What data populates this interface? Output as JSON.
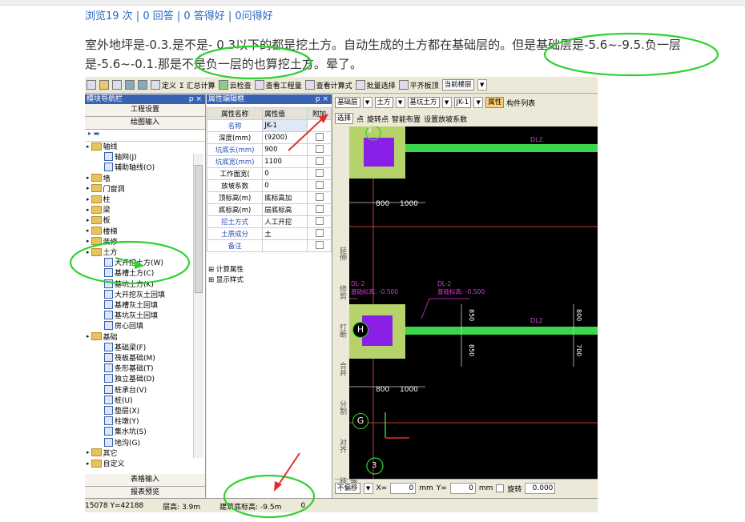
{
  "stats_line": "浏览19 次 | 0 回答 | 0 答得好 | 0问得好",
  "paragraph": "室外地坪是-0.3.是不是- 0.3以下的都是挖土方。自动生成的土方都在基础层的。但是基础层是-5.6~-9.5.负一层是-5.6~-0.1.那是不是负一层的也算挖土方。晕了。",
  "toolbar": {
    "items": [
      "定义",
      "Σ 汇总计算",
      "云检查",
      "查看工程量",
      "查看计算式",
      "批量选择",
      "平齐板顶",
      "当前楼层"
    ]
  },
  "nav": {
    "title": "模块导航栏",
    "pin": "p  ×",
    "buttons": [
      "工程设置",
      "绘图输入"
    ],
    "bottom_buttons": [
      "表格输入",
      "报表预览"
    ],
    "tree": [
      {
        "label": "轴线",
        "level": 0,
        "type": "folder"
      },
      {
        "label": "轴网(J)",
        "level": 1,
        "type": "leaf"
      },
      {
        "label": "辅助轴线(O)",
        "level": 1,
        "type": "leaf"
      },
      {
        "label": "墙",
        "level": 0,
        "type": "folder"
      },
      {
        "label": "门窗洞",
        "level": 0,
        "type": "folder"
      },
      {
        "label": "柱",
        "level": 0,
        "type": "folder"
      },
      {
        "label": "梁",
        "level": 0,
        "type": "folder"
      },
      {
        "label": "板",
        "level": 0,
        "type": "folder"
      },
      {
        "label": "楼梯",
        "level": 0,
        "type": "folder"
      },
      {
        "label": "装修",
        "level": 0,
        "type": "folder"
      },
      {
        "label": "土方",
        "level": 0,
        "type": "folder"
      },
      {
        "label": "大开挖土方(W)",
        "level": 1,
        "type": "leaf"
      },
      {
        "label": "基槽土方(C)",
        "level": 1,
        "type": "leaf"
      },
      {
        "label": "基坑土方(K)",
        "level": 1,
        "type": "leaf"
      },
      {
        "label": "大开挖灰土回填",
        "level": 1,
        "type": "leaf"
      },
      {
        "label": "基槽灰土回填",
        "level": 1,
        "type": "leaf"
      },
      {
        "label": "基坑灰土回填",
        "level": 1,
        "type": "leaf"
      },
      {
        "label": "房心回填",
        "level": 1,
        "type": "leaf"
      },
      {
        "label": "基础",
        "level": 0,
        "type": "folder"
      },
      {
        "label": "基础梁(F)",
        "level": 1,
        "type": "leaf"
      },
      {
        "label": "筏板基础(M)",
        "level": 1,
        "type": "leaf"
      },
      {
        "label": "条形基础(T)",
        "level": 1,
        "type": "leaf"
      },
      {
        "label": "独立基础(D)",
        "level": 1,
        "type": "leaf"
      },
      {
        "label": "桩承台(V)",
        "level": 1,
        "type": "leaf"
      },
      {
        "label": "桩(U)",
        "level": 1,
        "type": "leaf"
      },
      {
        "label": "垫层(X)",
        "level": 1,
        "type": "leaf"
      },
      {
        "label": "柱墩(Y)",
        "level": 1,
        "type": "leaf"
      },
      {
        "label": "集水坑(S)",
        "level": 1,
        "type": "leaf"
      },
      {
        "label": "地沟(G)",
        "level": 1,
        "type": "leaf"
      },
      {
        "label": "其它",
        "level": 0,
        "type": "folder"
      },
      {
        "label": "自定义",
        "level": 0,
        "type": "folder"
      }
    ]
  },
  "props": {
    "title": "属性编辑框",
    "pin": "p  ×",
    "headers": [
      "属性名称",
      "属性值",
      "附加"
    ],
    "rows": [
      {
        "name": "名称",
        "value": "JK-1",
        "blue": true
      },
      {
        "name": "深度(mm)",
        "value": "(9200)",
        "blue": false
      },
      {
        "name": "坑底长(mm)",
        "value": "900",
        "blue": true
      },
      {
        "name": "坑底宽(mm)",
        "value": "1100",
        "blue": true
      },
      {
        "name": "工作面宽(",
        "value": "0",
        "blue": false
      },
      {
        "name": "放坡系数",
        "value": "0",
        "blue": false
      },
      {
        "name": "顶标高(m)",
        "value": "底标高加",
        "blue": false
      },
      {
        "name": "底标高(m)",
        "value": "层底标高",
        "blue": false
      },
      {
        "name": "挖土方式",
        "value": "人工开挖",
        "blue": true
      },
      {
        "name": "土质成分",
        "value": "土",
        "blue": true
      },
      {
        "name": "备注",
        "value": "",
        "blue": true
      }
    ],
    "groups": [
      "计算属性",
      "显示样式"
    ]
  },
  "canvas_toolbar": {
    "floor": "基础层",
    "type": "土方",
    "subtype": "基坑土方",
    "component": "JK-1",
    "attr_btn": "属性",
    "list_btn": "构件列表",
    "row2": [
      "选择",
      "点",
      "旋转点",
      "智能布置",
      "设置放坡系数"
    ]
  },
  "vtools": [
    "延伸",
    "修剪",
    "打断",
    "合并",
    "分割",
    "对齐",
    "偏移"
  ],
  "canvas": {
    "axis_top": "3",
    "axis_bottom": "3",
    "axis_h": "H",
    "axis_g": "G",
    "dim_a": "800",
    "dim_b": "1000",
    "dim_c": "800",
    "dim_d": "1000",
    "dim_v1": "850",
    "dim_v2": "850",
    "dim_v3": "800",
    "dim_v4": "700",
    "dl_top": "DL2",
    "dl_mid": "DL2",
    "tag1": "DL-2",
    "tag1b": "基础标高: -0.500",
    "tag2": "DL-2",
    "tag2b": "基础标高: -0.500"
  },
  "status_inner": {
    "mode": "不偏移",
    "x_label": "X=",
    "x_val": "0",
    "unit1": "mm",
    "y_label": "Y=",
    "y_val": "0",
    "unit2": "mm",
    "rotate": "旋转",
    "rot_val": "0.000"
  },
  "statusbar": {
    "coords": "15078 Y=42188",
    "floor_h": "层高: 3.9m",
    "bottom_elev": "建筑底标高: -9.5m",
    "extra": "0"
  }
}
